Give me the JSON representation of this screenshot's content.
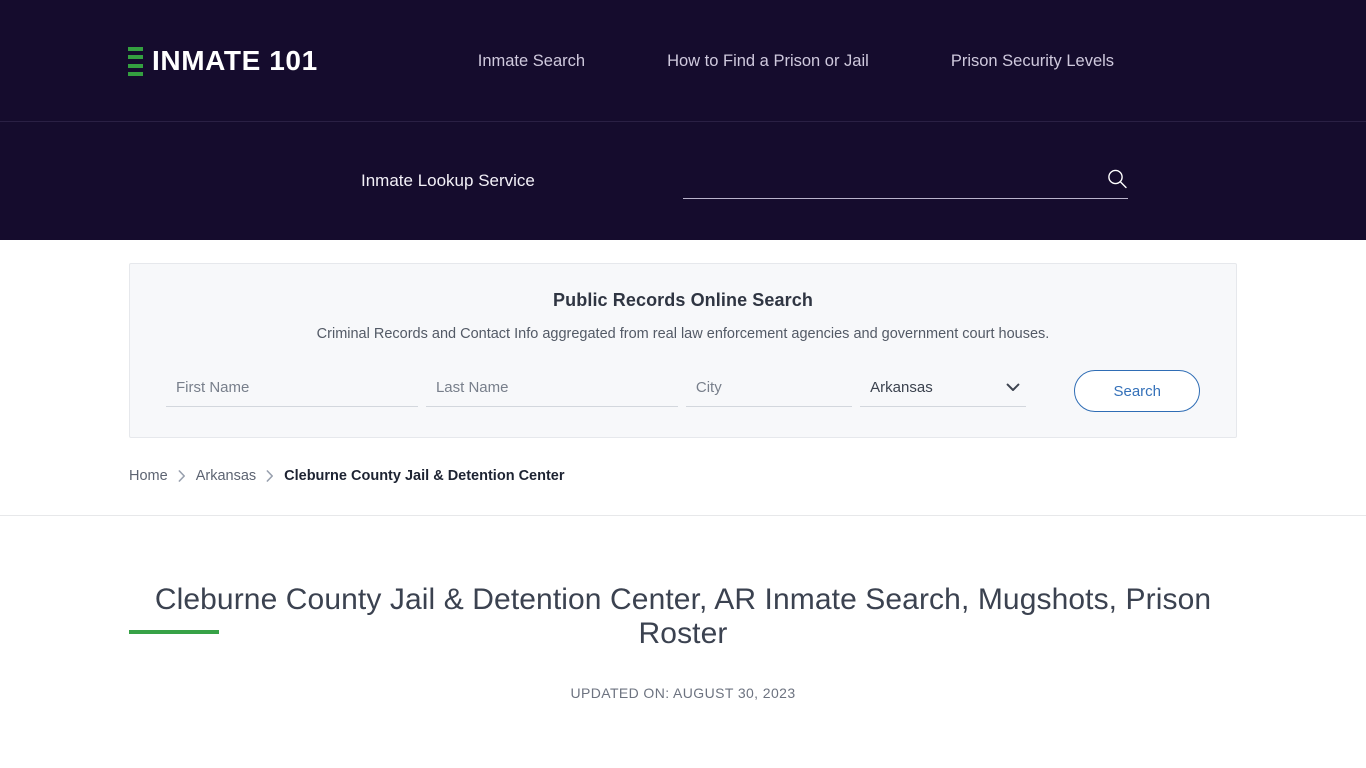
{
  "brand": {
    "name": "INMATE 101",
    "logo_icon": "stacked-bars-icon",
    "accent_green": "#34a040",
    "header_bg": "#150c2d"
  },
  "nav": {
    "items": [
      {
        "label": "Inmate Search"
      },
      {
        "label": "How to Find a Prison or Jail"
      },
      {
        "label": "Prison Security Levels"
      }
    ]
  },
  "lookup": {
    "label": "Inmate Lookup Service",
    "value": "",
    "placeholder": "",
    "search_icon": "magnifier-icon"
  },
  "records": {
    "title": "Public Records Online Search",
    "subtitle": "Criminal Records and Contact Info aggregated from real law enforcement agencies and government court houses.",
    "fields": {
      "first_name": {
        "placeholder": "First Name",
        "value": ""
      },
      "last_name": {
        "placeholder": "Last Name",
        "value": ""
      },
      "city": {
        "placeholder": "City",
        "value": ""
      },
      "state": {
        "selected": "Arkansas",
        "options": [
          "Arkansas"
        ],
        "chevron_icon": "chevron-down-icon"
      }
    },
    "submit_label": "Search",
    "accent_blue": "#3571b9"
  },
  "breadcrumb": {
    "items": [
      {
        "label": "Home",
        "current": false
      },
      {
        "label": "Arkansas",
        "current": false
      },
      {
        "label": "Cleburne County Jail & Detention Center",
        "current": true
      }
    ],
    "separator_icon": "chevron-right-icon"
  },
  "page": {
    "title": "Cleburne County Jail & Detention Center, AR Inmate Search, Mugshots, Prison Roster",
    "updated": "UPDATED ON: AUGUST 30, 2023",
    "rule_color": "#37a247"
  }
}
